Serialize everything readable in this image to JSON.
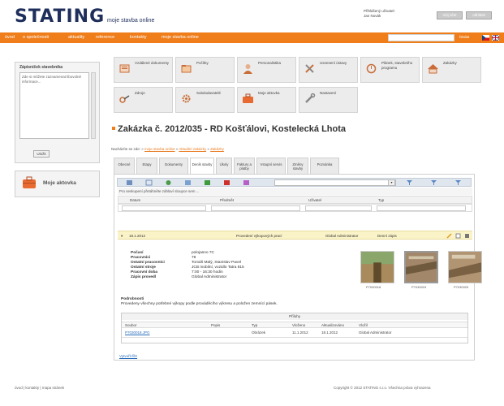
{
  "header": {
    "logo": "STATING",
    "logo_sub": "moje stavba online",
    "user_label": "Přihlášený uživatel:",
    "user_name": "Jan Novák",
    "btn_account": "můj účet",
    "btn_logout": "odhlásit"
  },
  "nav": {
    "items": [
      "úvod",
      "o společnosti",
      "aktuality",
      "reference",
      "kontakty",
      "moje stavba online"
    ],
    "search_label": "hledat"
  },
  "sidebar": {
    "box_title": "Zápisníček stavebníka",
    "box_text": "Zde si můžete zaznamenat libovolné informace...",
    "box_btn": "Uložit",
    "bag_label": "Moje aktovka"
  },
  "tiles": [
    {
      "label": "Vzdálené dokumenty"
    },
    {
      "label": "Počítky"
    },
    {
      "label": "Personalistika"
    },
    {
      "label": "Usnesení ústavy"
    },
    {
      "label": "Plánek, stavebního programu"
    },
    {
      "label": "Zakázky"
    },
    {
      "label": "Zdroje"
    },
    {
      "label": "Subdodavatelé"
    },
    {
      "label": "Moje aktovka"
    },
    {
      "label": "Nastavení"
    }
  ],
  "order": {
    "title": "Zakázka č. 2012/035 - RD Košťálovi, Kostelecká Lhota",
    "breadcrumb_prefix": "Nacházíte se zde: »",
    "breadcrumb_1": "moje stavba online",
    "breadcrumb_2": "Aktuální zakázky",
    "breadcrumb_3": "Zakázky"
  },
  "tabs": [
    "Obecné",
    "Etapy",
    "Dokumenty",
    "Deník stavby",
    "Úkoly",
    "Faktury a platby",
    "Vstupní servis",
    "Změny stavby",
    "Pozvánka"
  ],
  "grid": {
    "group_hint": "Pro seskupení přetáhněte záhlaví sloupce sem ...",
    "columns": [
      "Datum",
      "Předmět",
      "Uživatel",
      "Typ"
    ],
    "row": {
      "date": "18.1.2012",
      "subject": "Provedení výkopových prací",
      "user": "Global Administrator",
      "type": "Denní zápis"
    },
    "details": [
      {
        "label": "Počasí",
        "value": "polojasno 7C"
      },
      {
        "label": "Pracovníci",
        "value": "78"
      },
      {
        "label": "Ostatní pracovníci",
        "value": "Tomáš Malý, Stanislav Pavel"
      },
      {
        "label": "Ostatní stroje",
        "value": "JCB mobilní, vozidlo Tatra 815"
      },
      {
        "label": "Pracovní doba",
        "value": "7:00 - 16:30 hodin"
      },
      {
        "label": "Zápis provedl",
        "value": "Global Administrator"
      }
    ],
    "photos": [
      "P7030018",
      "P7030019",
      "P7030020"
    ],
    "detail_head": "Podrobnosti",
    "detail_text": "Provedeny všechny potřebné výkopy podle prováděcího výkresu a položen zemnící pásek.",
    "attachments": {
      "caption": "Přílohy",
      "columns": [
        "Soubor",
        "Popis",
        "Typ",
        "Vloženo",
        "Aktualizováno",
        "Vložil"
      ],
      "row": [
        "P7030018.JPG",
        "",
        "Obrázek",
        "11.1.2012",
        "18.1.2012",
        "Global Administrator"
      ]
    },
    "bottom_link": "Vytvořit filtr"
  },
  "footer": {
    "left": "úvod | kontakty | mapa stránek",
    "right": "Copyright © 2012 STATING s.r.o. Všechna práva vyhrazena"
  },
  "colors": {
    "accent": "#ef7d1a",
    "brand": "#1f2f5c",
    "row_highlight": "#fbf3c8"
  }
}
